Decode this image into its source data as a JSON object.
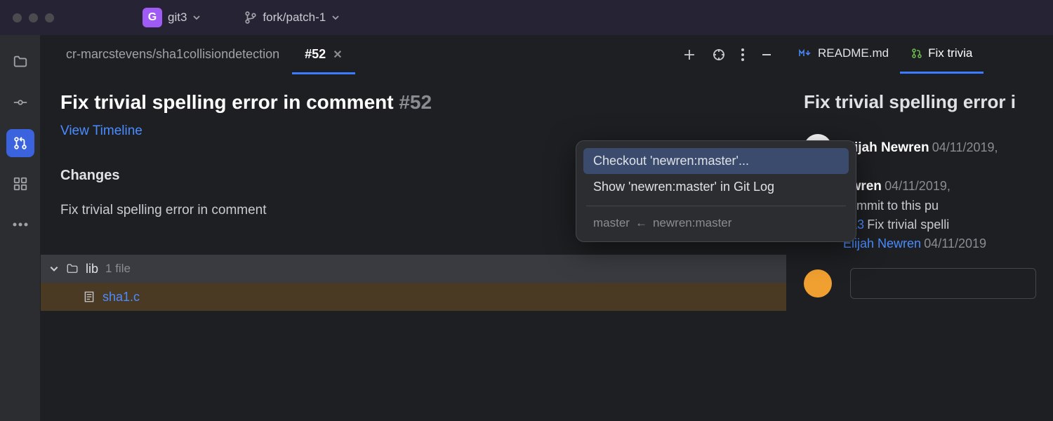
{
  "titlebar": {
    "project_badge": "G",
    "project_name": "git3",
    "branch_name": "fork/patch-1"
  },
  "sidebar": {
    "items": [
      "folder",
      "commit",
      "pull-request",
      "apps",
      "more"
    ]
  },
  "tabs": {
    "repo_path": "cr-marcstevens/sha1collisiondetection",
    "active_label": "#52"
  },
  "pr": {
    "title": "Fix trivial spelling error in comment",
    "number": "#52",
    "view_timeline": "View Timeline",
    "changes_label": "Changes",
    "branch_chip": "newren:master",
    "commit_message": "Fix trivial spelling error in comment",
    "folder_name": "lib",
    "folder_meta": "1 file",
    "file_name": "sha1.c"
  },
  "context_menu": {
    "item1": "Checkout 'newren:master'...",
    "item2": "Show 'newren:master' in Git Log",
    "footer_left": "master",
    "footer_right": "newren:master"
  },
  "right_panel": {
    "tab1": "README.md",
    "tab2": "Fix trivia",
    "title": "Fix trivial spelling error i",
    "author1": "Elijah Newren",
    "date1": "04/11/2019,",
    "author2_partial": "ewren",
    "date2": "04/11/2019,",
    "line2": "commit to this pu",
    "commit_hash": "oa3",
    "commit_text": "Fix trivial spelli",
    "author3": "Elijah Newren",
    "date3": "04/11/2019"
  }
}
